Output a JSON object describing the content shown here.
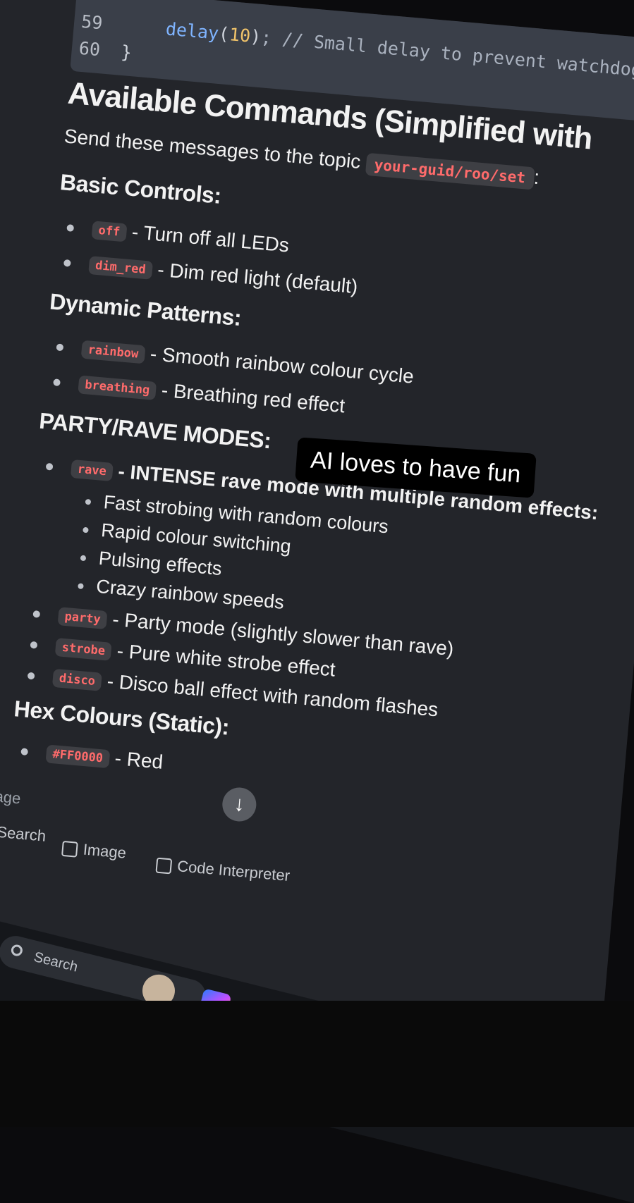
{
  "code": {
    "lines": [
      {
        "num": "59",
        "fn": "delay",
        "arg": "10",
        "rest": "; // Small delay to prevent watchdog is"
      },
      {
        "num": "60",
        "text": "}"
      }
    ]
  },
  "section_title": "Available Commands (Simplified with",
  "intro": {
    "text": "Send these messages to the topic",
    "topic": "your-guid/roo/set",
    "suffix": ":"
  },
  "groups": {
    "basic": {
      "title": "Basic Controls:",
      "items": [
        {
          "cmd": "off",
          "desc": "- Turn off all LEDs"
        },
        {
          "cmd": "dim_red",
          "desc": "- Dim red light (default)"
        }
      ]
    },
    "dynamic": {
      "title": "Dynamic Patterns:",
      "items": [
        {
          "cmd": "rainbow",
          "desc": "- Smooth rainbow colour cycle"
        },
        {
          "cmd": "breathing",
          "desc": "- Breathing red effect"
        }
      ]
    },
    "party": {
      "title": "PARTY/RAVE MODES:",
      "rave": {
        "cmd": "rave",
        "desc": "- INTENSE rave mode with multiple random effects:"
      },
      "sub_items": [
        "Fast strobing with random colours",
        "Rapid colour switching",
        "Pulsing effects",
        "Crazy rainbow speeds"
      ],
      "items": [
        {
          "cmd": "party",
          "desc": "- Party mode (slightly slower than rave)"
        },
        {
          "cmd": "strobe",
          "desc": "- Pure white strobe effect"
        },
        {
          "cmd": "disco",
          "desc": "- Disco ball effect with random flashes"
        }
      ]
    },
    "hex": {
      "title": "Hex Colours (Static):",
      "items": [
        {
          "cmd": "#FF0000",
          "desc": "- Red"
        }
      ]
    }
  },
  "caption": "AI loves to have fun",
  "composer": {
    "placeholder": "end a Message",
    "tools": {
      "web_search": "Web Search",
      "image": "Image",
      "code_interpreter": "Code Interpreter"
    }
  },
  "taskbar": {
    "search_placeholder": "Search",
    "apps": [
      "avatar-icon",
      "copilot-icon",
      "firefox-icon",
      "file-explorer-icon",
      "terminal-icon",
      "vscode-icon",
      "emoji-app-icon",
      "pin-app-icon",
      "infinity-app-icon"
    ]
  },
  "colors": {
    "code_bg": "#3a3f49",
    "page_bg": "#23252a",
    "pill_text": "#ff6b6b"
  }
}
